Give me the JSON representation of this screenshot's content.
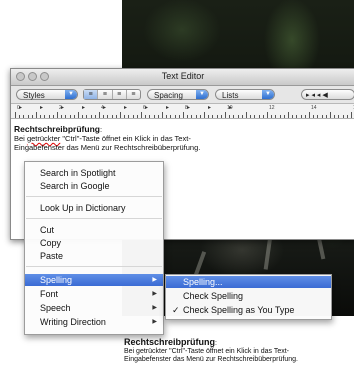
{
  "window": {
    "title": "Text Editor"
  },
  "toolbar": {
    "styles_label": "Styles",
    "spacing_label": "Spacing",
    "lists_label": "Lists",
    "align_buttons": [
      "left",
      "center",
      "justify",
      "right"
    ]
  },
  "ruler": {
    "numbers": [
      "0",
      "2",
      "4",
      "6",
      "8",
      "10",
      "12",
      "14",
      "16"
    ]
  },
  "document": {
    "heading": "Rechtschreibprüfung",
    "heading_colon": ":",
    "line1_a": "Bei ",
    "line1_misspelled": "getrückter",
    "line1_b": " \"Ctrl\"-Taste öffnet ein Klick in das Text-",
    "line2": "Eingabefenster das Menü zur Rechtschreibüberprüfung."
  },
  "context_menu": {
    "items": [
      "Search in Spotlight",
      "Search in Google",
      "Look Up in Dictionary",
      "Cut",
      "Copy",
      "Paste",
      "Spelling",
      "Font",
      "Speech",
      "Writing Direction"
    ],
    "highlighted": "Spelling"
  },
  "spelling_submenu": {
    "items": [
      "Spelling...",
      "Check Spelling",
      "Check Spelling as You Type"
    ],
    "highlighted": "Spelling...",
    "checked": "Check Spelling as You Type",
    "check_mark": "✓"
  },
  "caption": {
    "heading": "Rechtschreibprüfung",
    "heading_colon": ":",
    "line1": "Bei getrückter \"Ctrl\"-Taste öffnet ein Klick in das Text-",
    "line2": "Eingabefenster das Menü zur Rechtschreibüberprüfung."
  },
  "colors": {
    "highlight": "#3a6bd4",
    "misspelling_underline": "#dd0000"
  }
}
